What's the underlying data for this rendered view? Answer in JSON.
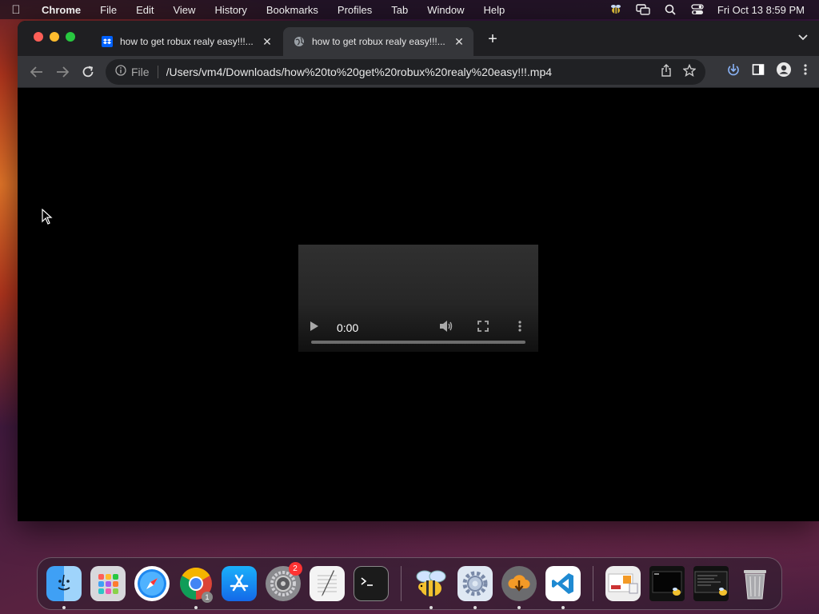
{
  "menubar": {
    "app_name": "Chrome",
    "items": [
      "File",
      "Edit",
      "View",
      "History",
      "Bookmarks",
      "Profiles",
      "Tab",
      "Window",
      "Help"
    ],
    "clock": "Fri Oct 13  8:59 PM"
  },
  "tabs": [
    {
      "title": "how to get robux realy easy!!!...",
      "favicon": "dropbox-icon",
      "active": false
    },
    {
      "title": "how to get robux realy easy!!!...",
      "favicon": "globe-icon",
      "active": true
    }
  ],
  "omnibox": {
    "scheme_label": "File",
    "url": "/Users/vm4/Downloads/how%20to%20get%20robux%20realy%20easy!!!.mp4"
  },
  "video": {
    "time": "0:00",
    "progress": 0
  },
  "dock": {
    "settings_badge": "2",
    "chrome_badge": "1"
  },
  "colors": {
    "toolbar": "#35363a",
    "tabbar": "#1f1f22",
    "close": "#fe5f57",
    "minimize": "#febc2e",
    "zoom": "#28c840"
  }
}
